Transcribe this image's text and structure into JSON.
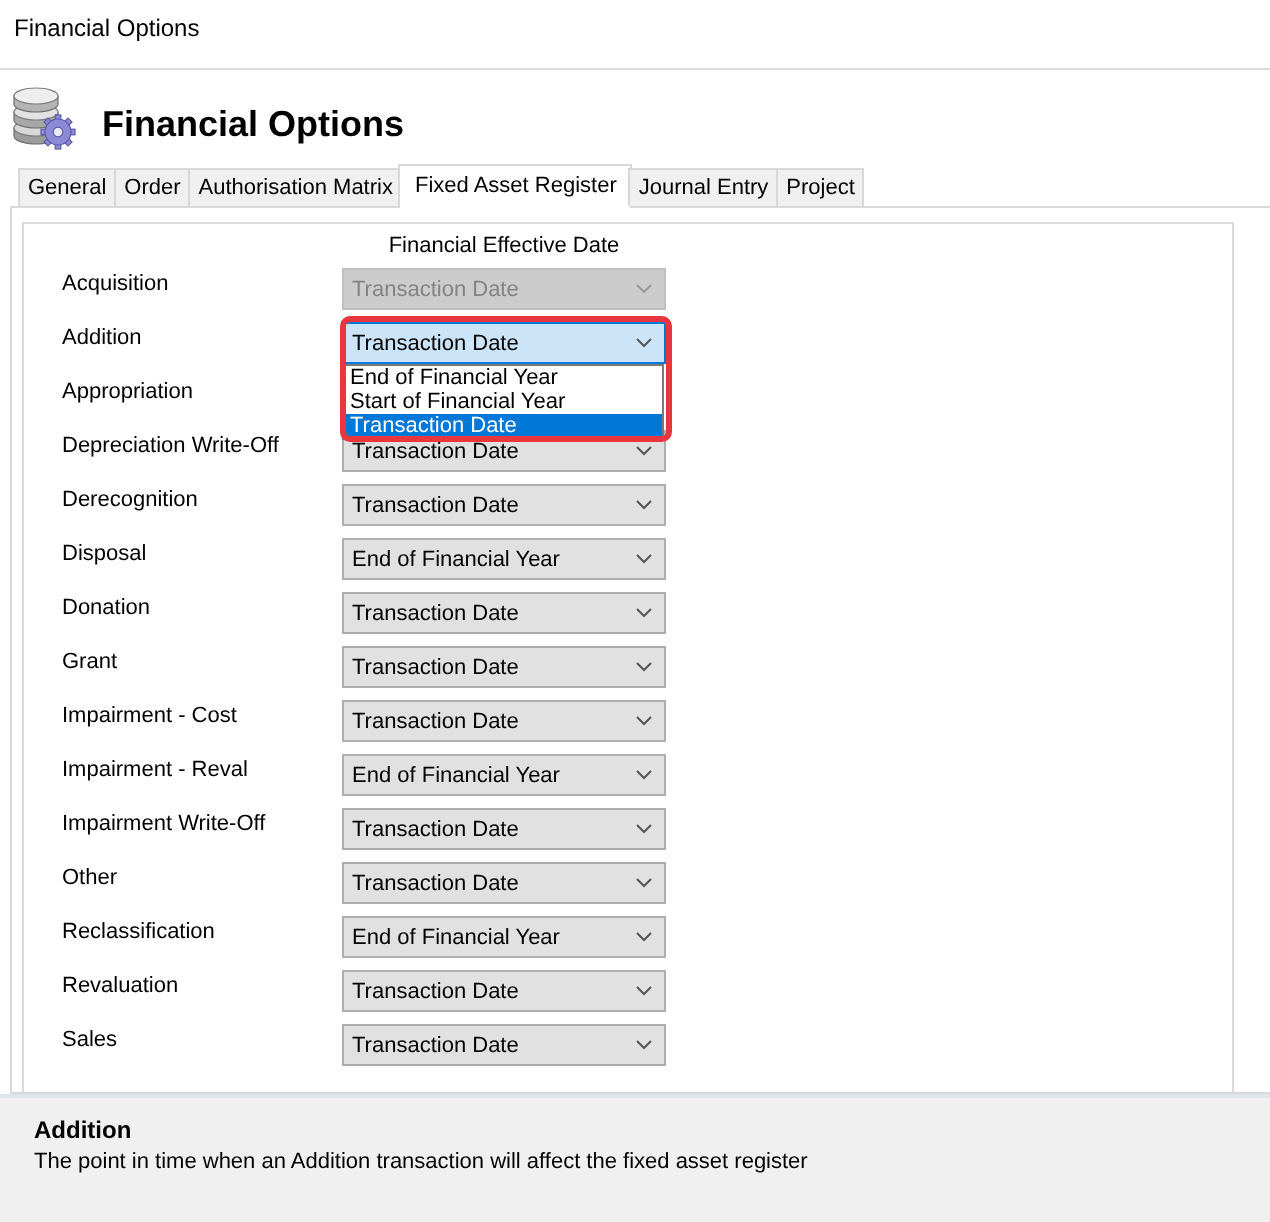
{
  "window": {
    "title": "Financial Options"
  },
  "header": {
    "title": "Financial Options"
  },
  "tabs": [
    {
      "label": "General",
      "selected": false
    },
    {
      "label": "Order",
      "selected": false
    },
    {
      "label": "Authorisation Matrix",
      "selected": false
    },
    {
      "label": "Fixed Asset Register",
      "selected": true
    },
    {
      "label": "Journal Entry",
      "selected": false
    },
    {
      "label": "Project",
      "selected": false
    }
  ],
  "panel": {
    "column_heading": "Financial Effective Date",
    "rows": [
      {
        "label": "Acquisition",
        "value": "Transaction Date",
        "disabled": true,
        "selected": false
      },
      {
        "label": "Addition",
        "value": "Transaction Date",
        "disabled": false,
        "selected": true
      },
      {
        "label": "Appropriation"
      },
      {
        "label": "Depreciation Write-Off",
        "value": "Transaction Date",
        "disabled": false,
        "selected": false
      },
      {
        "label": "Derecognition",
        "value": "Transaction Date",
        "disabled": false,
        "selected": false
      },
      {
        "label": "Disposal",
        "value": "End of Financial Year",
        "disabled": false,
        "selected": false
      },
      {
        "label": "Donation",
        "value": "Transaction Date",
        "disabled": false,
        "selected": false
      },
      {
        "label": "Grant",
        "value": "Transaction Date",
        "disabled": false,
        "selected": false
      },
      {
        "label": "Impairment - Cost",
        "value": "Transaction Date",
        "disabled": false,
        "selected": false
      },
      {
        "label": "Impairment - Reval",
        "value": "End of Financial Year",
        "disabled": false,
        "selected": false
      },
      {
        "label": "Impairment Write-Off",
        "value": "Transaction Date",
        "disabled": false,
        "selected": false
      },
      {
        "label": "Other",
        "value": "Transaction Date",
        "disabled": false,
        "selected": false
      },
      {
        "label": "Reclassification",
        "value": "End of Financial Year",
        "disabled": false,
        "selected": false
      },
      {
        "label": "Revaluation",
        "value": "Transaction Date",
        "disabled": false,
        "selected": false
      },
      {
        "label": "Sales",
        "value": "Transaction Date",
        "disabled": false,
        "selected": false
      }
    ],
    "open_list": {
      "highlighted": true,
      "options": [
        {
          "label": "End of Financial Year",
          "selected": false
        },
        {
          "label": "Start of Financial Year",
          "selected": false
        },
        {
          "label": "Transaction Date",
          "selected": true
        }
      ]
    }
  },
  "description": {
    "title": "Addition",
    "text": "The point in time when an Addition transaction will affect the fixed asset register"
  }
}
